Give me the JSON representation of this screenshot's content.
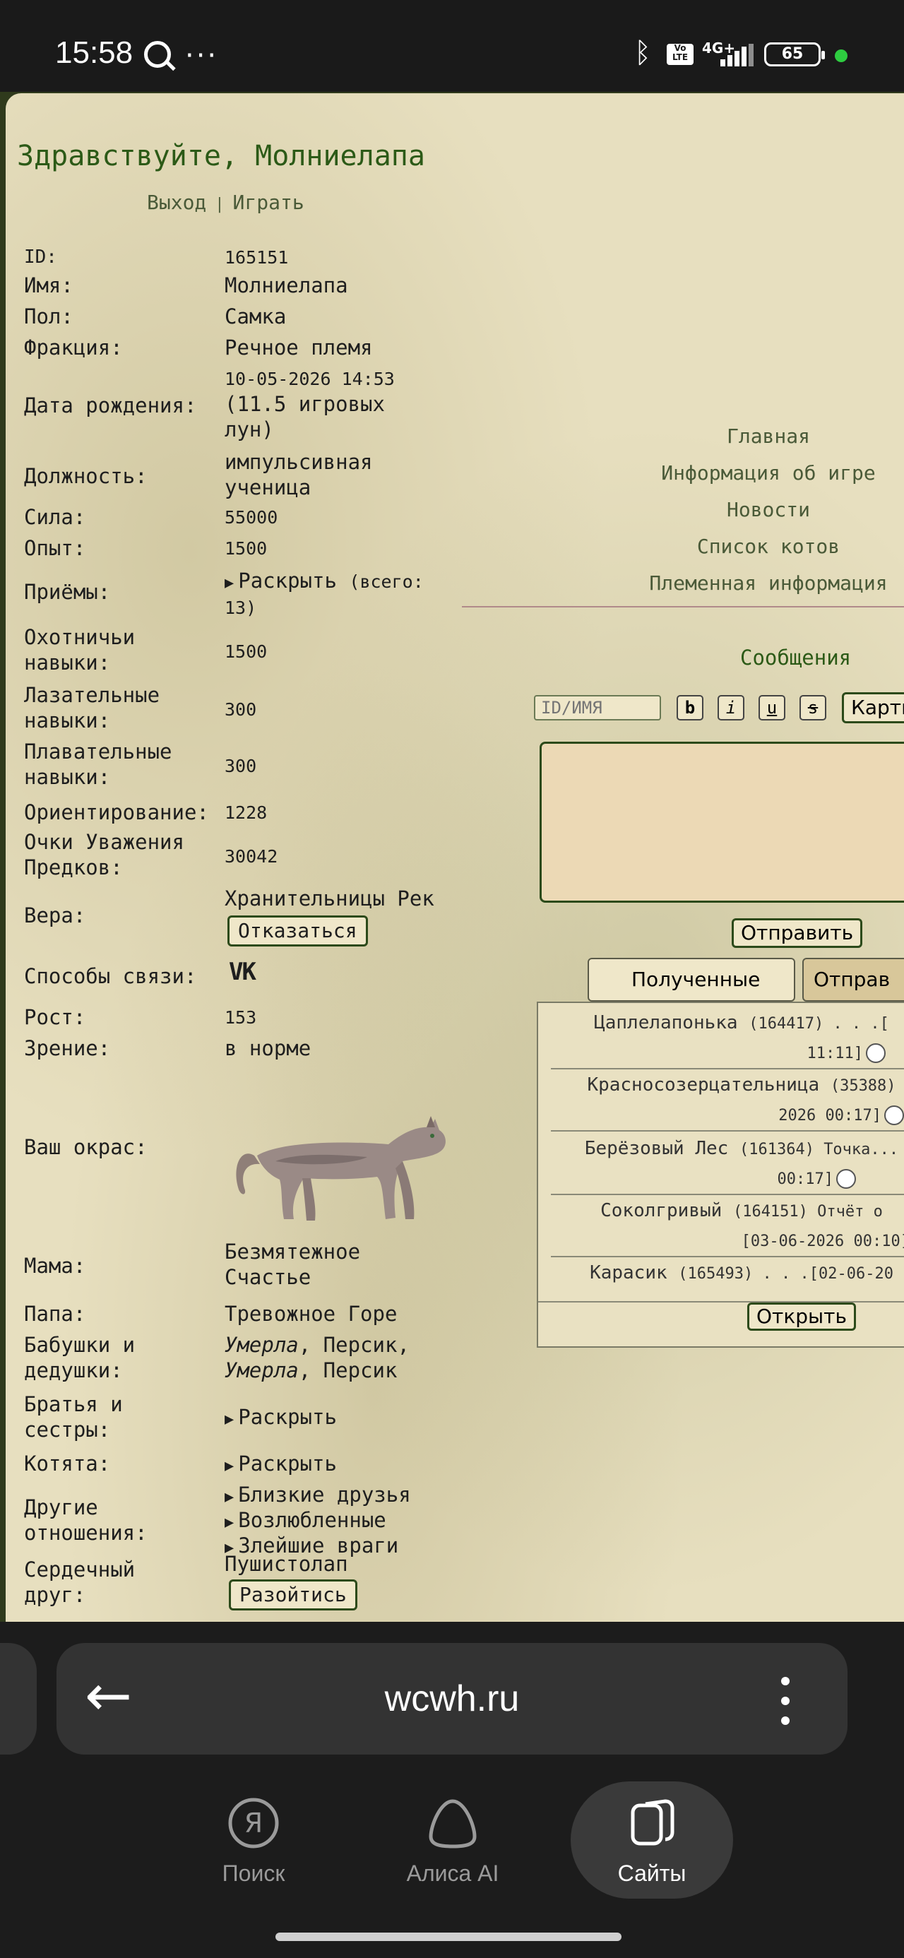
{
  "status_bar": {
    "time": "15:58",
    "network": "4G+",
    "volte": "Vo LTE",
    "battery": "65"
  },
  "profile": {
    "greeting": "Здравствуйте, Молниелапа",
    "links": {
      "logout": "Выход",
      "separator": "|",
      "play": "Играть"
    },
    "fields": {
      "id": {
        "label": "ID:",
        "value": "165151"
      },
      "name": {
        "label": "Имя:",
        "value": "Молниелапа"
      },
      "sex": {
        "label": "Пол:",
        "value": "Самка"
      },
      "faction": {
        "label": "Фракция:",
        "value": "Речное племя"
      },
      "birth": {
        "label": "Дата рождения:",
        "value1": "10-05-2026 14:53",
        "value2": "(11.5 игровых",
        "value3": "лун)"
      },
      "position": {
        "label": "Должность:",
        "value1": "импульсивная",
        "value2": "ученица"
      },
      "strength": {
        "label": "Сила:",
        "value": "55000"
      },
      "experience": {
        "label": "Опыт:",
        "value": "1500"
      },
      "techniques": {
        "label": "Приёмы:",
        "value1": "Раскрыть",
        "value2": "(всего:",
        "value3": "13)"
      },
      "hunting": {
        "label1": "Охотничьи",
        "label2": "навыки:",
        "value": "1500"
      },
      "climbing": {
        "label1": "Лазательные",
        "label2": "навыки:",
        "value": "300"
      },
      "swimming": {
        "label1": "Плавательные",
        "label2": "навыки:",
        "value": "300"
      },
      "orientation": {
        "label": "Ориентирование:",
        "value": "1228"
      },
      "respect": {
        "label1": "Очки Уважения",
        "label2": "Предков:",
        "value": "30042"
      },
      "faith": {
        "label": "Вера:",
        "value": "Хранительницы Рек",
        "button": "Отказаться"
      },
      "contacts": {
        "label": "Способы связи:",
        "icon": "vk-icon",
        "icon_text": "VK"
      },
      "height": {
        "label": "Рост:",
        "value": "153"
      },
      "vision": {
        "label": "Зрение:",
        "value": "в норме"
      },
      "color": {
        "label": "Ваш окрас:"
      },
      "mother": {
        "label": "Мама:",
        "value1": "Безмятежное",
        "value2": "Счастье"
      },
      "father": {
        "label": "Папа:",
        "value": "Тревожное Горе"
      },
      "grandparents": {
        "label1": "Бабушки и",
        "label2": "дедушки:",
        "dead": "Умерла",
        "name": ", Персик,",
        "dead2": "Умерла",
        "name2": ", Персик"
      },
      "siblings": {
        "label1": "Братья и",
        "label2": "сестры:",
        "value": "Раскрыть"
      },
      "kittens": {
        "label": "Котята:",
        "value": "Раскрыть"
      },
      "relations": {
        "label1": "Другие",
        "label2": "отношения:",
        "items": [
          "Близкие друзья",
          "Возлюбленные",
          "Злейшие враги"
        ]
      },
      "sweetheart": {
        "label1": "Сердечный",
        "label2": "друг:",
        "value": "Пушистолап",
        "button": "Разойтись"
      }
    }
  },
  "nav": {
    "items": [
      "Главная",
      "Информация об игре",
      "Новости",
      "Список котов",
      "Племенная информация"
    ]
  },
  "messages": {
    "title": "Сообщения",
    "id_placeholder": "ID/ИМЯ",
    "format_buttons": [
      "b",
      "i",
      "u",
      "s"
    ],
    "image_button": "Карти",
    "send_button": "Отправить",
    "tabs": {
      "received": "Полученные",
      "sent": "Отправ"
    },
    "items": [
      {
        "line1": "Цаплелапонька",
        "line1b": "(164417) . . .[",
        "line2": "11:11]"
      },
      {
        "line1": "Красносозерцательница",
        "line1b": "(35388)",
        "line2": "2026 00:17]"
      },
      {
        "line1": "Берёзовый Лес",
        "line1b": "(161364) Точка...",
        "line2": "00:17]"
      },
      {
        "line1": "Соколгривый",
        "line1b": "(164151) Отчёт о",
        "line2": "[03-06-2026 00:10]"
      },
      {
        "line1": "Карасик",
        "line1b": "(165493) . . .[02-06-20"
      }
    ],
    "open_button": "Открыть"
  },
  "browser": {
    "url": "wcwh.ru",
    "tabs": [
      "Поиск",
      "Алиса AI",
      "Сайты"
    ]
  }
}
